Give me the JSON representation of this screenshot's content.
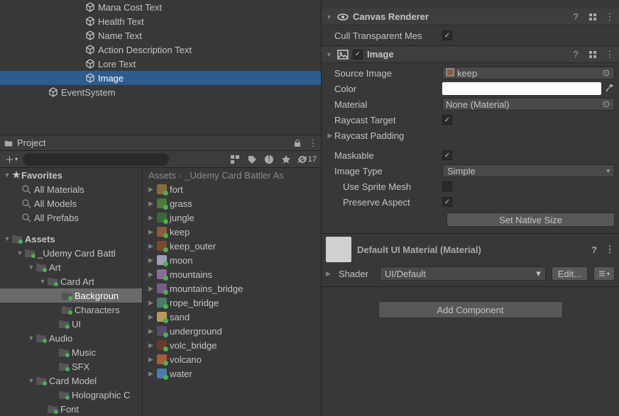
{
  "hierarchy": {
    "items": [
      {
        "indent": 120,
        "label": "Mana Cost Text",
        "selected": false
      },
      {
        "indent": 120,
        "label": "Health Text",
        "selected": false
      },
      {
        "indent": 120,
        "label": "Name Text",
        "selected": false
      },
      {
        "indent": 120,
        "label": "Action Description Text",
        "selected": false
      },
      {
        "indent": 120,
        "label": "Lore Text",
        "selected": false
      },
      {
        "indent": 120,
        "label": "Image",
        "selected": true
      },
      {
        "indent": 68,
        "label": "EventSystem",
        "selected": false
      }
    ]
  },
  "project": {
    "title": "Project",
    "search_placeholder": "",
    "eye_count": "17",
    "favorites": {
      "label": "Favorites",
      "items": [
        "All Materials",
        "All Models",
        "All Prefabs"
      ]
    },
    "assets_label": "Assets",
    "tree": [
      {
        "indent": 22,
        "expand": "▼",
        "label": "_Udemy Card Battl",
        "selected": false
      },
      {
        "indent": 38,
        "expand": "▼",
        "label": "Art",
        "selected": false
      },
      {
        "indent": 54,
        "expand": "▼",
        "label": "Card Art",
        "selected": false
      },
      {
        "indent": 74,
        "expand": "",
        "label": "Backgroun",
        "selected": true
      },
      {
        "indent": 74,
        "expand": "",
        "label": "Characters",
        "selected": false
      },
      {
        "indent": 70,
        "expand": "",
        "label": "UI",
        "selected": false
      },
      {
        "indent": 38,
        "expand": "▼",
        "label": "Audio",
        "selected": false
      },
      {
        "indent": 70,
        "expand": "",
        "label": "Music",
        "selected": false
      },
      {
        "indent": 70,
        "expand": "",
        "label": "SFX",
        "selected": false
      },
      {
        "indent": 38,
        "expand": "▼",
        "label": "Card Model",
        "selected": false
      },
      {
        "indent": 70,
        "expand": "",
        "label": "Holographic C",
        "selected": false
      },
      {
        "indent": 54,
        "expand": "",
        "label": "Font",
        "selected": false
      }
    ],
    "breadcrumb": [
      "Assets",
      "_Udemy Card Battler As"
    ],
    "assets": [
      {
        "label": "fort",
        "color": "#8a6a3a"
      },
      {
        "label": "grass",
        "color": "#4a7a3a"
      },
      {
        "label": "jungle",
        "color": "#356a3a"
      },
      {
        "label": "keep",
        "color": "#8a5a3a"
      },
      {
        "label": "keep_outer",
        "color": "#7a4a2a"
      },
      {
        "label": "moon",
        "color": "#9aa0b8"
      },
      {
        "label": "mountains",
        "color": "#8a6a9a"
      },
      {
        "label": "mountains_bridge",
        "color": "#7a5a8a"
      },
      {
        "label": "rope_bridge",
        "color": "#4a7a6a"
      },
      {
        "label": "sand",
        "color": "#b89a5a"
      },
      {
        "label": "underground",
        "color": "#5a4a6a"
      },
      {
        "label": "volc_bridge",
        "color": "#6a3a2a"
      },
      {
        "label": "volcano",
        "color": "#a85a3a"
      },
      {
        "label": "water",
        "color": "#4a7aaa"
      }
    ]
  },
  "inspector": {
    "canvas_renderer": {
      "title": "Canvas Renderer",
      "cull_label": "Cull Transparent Mes",
      "cull_value": true
    },
    "image": {
      "title": "Image",
      "enabled": true,
      "source_image_label": "Source Image",
      "source_image_value": "keep",
      "color_label": "Color",
      "color_value": "#ffffff",
      "material_label": "Material",
      "material_value": "None (Material)",
      "raycast_target_label": "Raycast Target",
      "raycast_target_value": true,
      "raycast_padding_label": "Raycast Padding",
      "maskable_label": "Maskable",
      "maskable_value": true,
      "image_type_label": "Image Type",
      "image_type_value": "Simple",
      "use_sprite_mesh_label": "Use Sprite Mesh",
      "use_sprite_mesh_value": false,
      "preserve_aspect_label": "Preserve Aspect",
      "preserve_aspect_value": true,
      "set_native_size_label": "Set Native Size"
    },
    "material": {
      "title": "Default UI Material (Material)",
      "shader_label": "Shader",
      "shader_value": "UI/Default",
      "edit_label": "Edit..."
    },
    "add_component_label": "Add Component"
  }
}
